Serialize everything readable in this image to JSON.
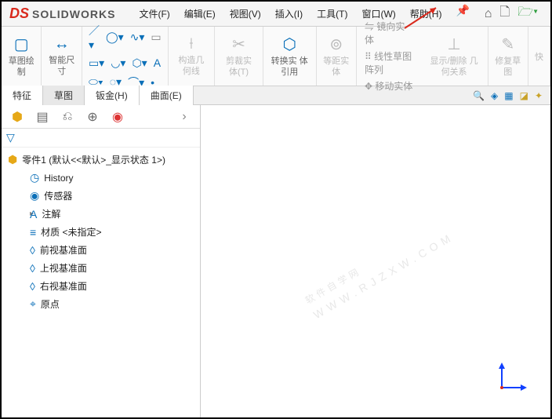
{
  "title": {
    "brand_ds": "DS",
    "brand_sw": "SOLIDWORKS"
  },
  "menu": {
    "file": "文件(F)",
    "edit": "编辑(E)",
    "view": "视图(V)",
    "insert": "插入(I)",
    "tools": "工具(T)",
    "window": "窗口(W)",
    "help": "帮助(H)"
  },
  "ribbon": {
    "sketch_draw": {
      "label": "草图绘\n制"
    },
    "smart_dim": {
      "label": "智能尺\n寸"
    },
    "construction": {
      "label": "构造几\n何线"
    },
    "trim": {
      "label": "剪裁实\n体(T)"
    },
    "convert": {
      "label": "转换实\n体引用"
    },
    "offset": {
      "label": "等距实\n体"
    },
    "mirror": "镜向实体",
    "pattern": "线性草图阵列",
    "move": "移动实体",
    "show_hide": {
      "label": "显示/删除\n几何关系"
    },
    "repair": {
      "label": "修复草\n图"
    },
    "quick": {
      "label": "快"
    }
  },
  "tabs": {
    "feature": "特征",
    "sketch": "草图",
    "sheetmetal": "钣金(H)",
    "surface": "曲面(E)"
  },
  "tree": {
    "root": "零件1  (默认<<默认>_显示状态 1>)",
    "history": "History",
    "sensors": "传感器",
    "annotations": "注解",
    "material": "材质 <未指定>",
    "front": "前视基准面",
    "top": "上视基准面",
    "right": "右视基准面",
    "origin": "原点"
  },
  "watermark": {
    "main": "软件自学网",
    "sub": "WWW.RJZXW.COM"
  }
}
